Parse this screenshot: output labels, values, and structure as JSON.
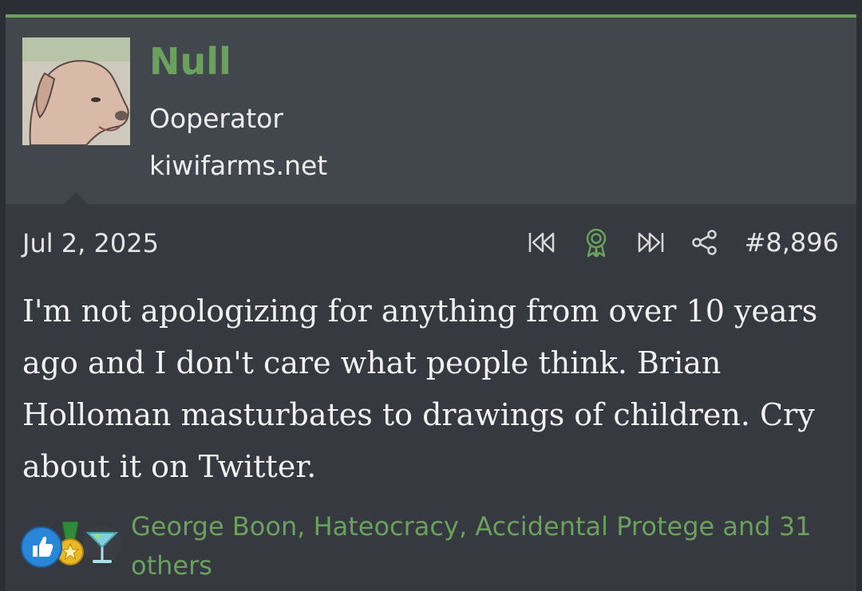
{
  "user": {
    "name": "Null",
    "title": "Ooperator",
    "site": "kiwifarms.net"
  },
  "post": {
    "date": "Jul 2, 2025",
    "number": "#8,896",
    "body": "I'm not apologizing for anything from over 10 years ago and I don't care what people think. Brian Holloman masturbates to drawings of children. Cry about it on Twitter."
  },
  "reactions": {
    "icons": [
      "like-icon",
      "medal-icon",
      "cocktail-icon"
    ],
    "summary": "George Boon, Hateocracy, Accidental Protege and 31 others"
  },
  "colors": {
    "accent": "#6aa15c",
    "header_bg": "#42464d",
    "post_bg": "#363940",
    "text": "#f2f2f2"
  },
  "action_icons": [
    "rewind-icon",
    "award-icon",
    "fast-forward-icon",
    "share-icon"
  ]
}
